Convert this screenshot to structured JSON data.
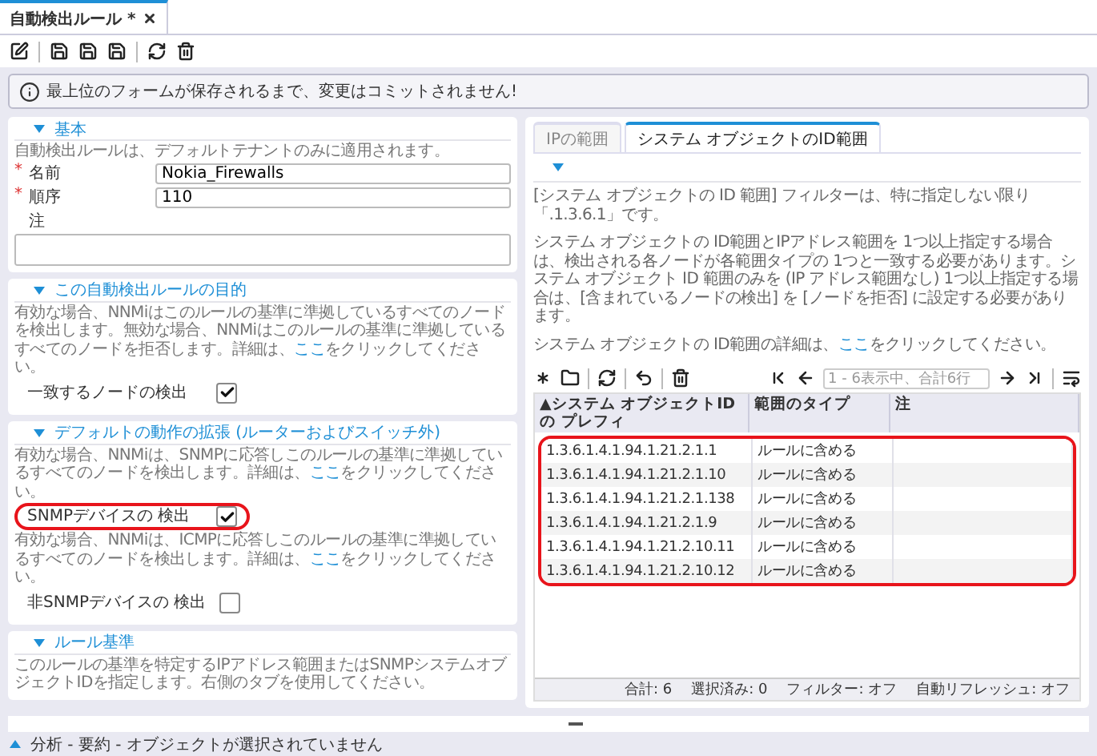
{
  "document_tab": {
    "label": "自動検出ルール *",
    "selected": true
  },
  "notice": "最上位のフォームが保存されるまで、変更はコミットされません!",
  "basic": {
    "title": "基本",
    "description": "自動検出ルールは、デフォルトテナントのみに適用されます。",
    "fields": [
      {
        "label": "名前",
        "required_mark": "*",
        "value": "Nokia_Firewalls",
        "kind": "text"
      },
      {
        "label": "順序",
        "required_mark": "*",
        "value": "110",
        "kind": "text"
      },
      {
        "label": "注",
        "kind": "textarea"
      }
    ]
  },
  "option_sections": [
    {
      "title": "この自動検出ルールの目的",
      "groups": [
        {
          "description": {
            "text": "有効な場合、NNMiはこのルールの基準に準拠しているすべてのノードを検出します。無効な場合、NNMiはこのルールの基準に準拠しているすべてのノードを拒否します。詳細は、",
            "link": "ここ",
            "after": "をクリックしてください。"
          },
          "checkbox": {
            "label": "一致するノードの検出",
            "checked": true,
            "highlighted": false
          }
        }
      ]
    },
    {
      "title": "デフォルトの動作の拡張 (ルーターおよびスイッチ外)",
      "groups": [
        {
          "description": {
            "text": "有効な場合、NNMiは、SNMPに応答しこのルールの基準に準拠しているすべてのノードを検出します。詳細は、",
            "link": "ここ",
            "after": "をクリックしてください。"
          },
          "checkbox": {
            "label": "SNMPデバイスの 検出",
            "checked": true,
            "highlighted": true
          }
        },
        {
          "description": {
            "text": "有効な場合、NNMiは、ICMPに応答しこのルールの基準に準拠しているすべてのノードを検出します。詳細は、",
            "link": "ここ",
            "after": "をクリックしてください。"
          },
          "checkbox": {
            "label": "非SNMPデバイスの 検出",
            "checked": false,
            "highlighted": false
          }
        }
      ]
    },
    {
      "title": "ルール基準",
      "groups": [
        {
          "description": {
            "text": "このルールの基準を特定するIPアドレス範囲またはSNMPシステムオブジェクトIDを指定します。右側のタブを使用してください。"
          }
        }
      ]
    }
  ],
  "tabs": [
    {
      "label": "IPの範囲",
      "selected": false
    },
    {
      "label": "システム オブジェクトのID範囲",
      "selected": true
    }
  ],
  "info_paragraphs": [
    {
      "text": "[システム オブジェクトの ID 範囲] フィルターは、特に指定しない限り「.1.3.6.1」です。"
    },
    {
      "text": "システム オブジェクトの ID範囲とIPアドレス範囲を 1つ以上指定する場合は、検出される各ノードが各範囲タイプの 1つと一致する必要があります。システム オブジェクト ID 範囲のみを (IP アドレス範囲なし) 1つ以上指定する場合は、[含まれているノードの検出] を [ノードを拒否] に設定する必要があります。"
    },
    {
      "text": "システム オブジェクトの ID範囲の詳細は、",
      "link": "ここ",
      "after": "をクリックしてください。"
    }
  ],
  "pager": "1 - 6表示中、合計6行",
  "table": {
    "highlighted": true,
    "columns": [
      "▲システム オブジェクトIDの プレフィ",
      "範囲のタイプ",
      "注"
    ],
    "rows": [
      {
        "prefix": "1.3.6.1.4.1.94.1.21.2.1.1",
        "type": "ルールに含める"
      },
      {
        "prefix": "1.3.6.1.4.1.94.1.21.2.1.10",
        "type": "ルールに含める"
      },
      {
        "prefix": "1.3.6.1.4.1.94.1.21.2.1.138",
        "type": "ルールに含める"
      },
      {
        "prefix": "1.3.6.1.4.1.94.1.21.2.1.9",
        "type": "ルールに含める"
      },
      {
        "prefix": "1.3.6.1.4.1.94.1.21.2.10.11",
        "type": "ルールに含める"
      },
      {
        "prefix": "1.3.6.1.4.1.94.1.21.2.10.12",
        "type": "ルールに含める"
      }
    ]
  },
  "table_footer": [
    "合計: 6",
    "選択済み: 0",
    "フィルター: オフ",
    "自動リフレッシュ: オフ"
  ],
  "status_bar": {
    "text": "分析 - 要約 - オブジェクトが選択されていません",
    "expanded": false
  }
}
